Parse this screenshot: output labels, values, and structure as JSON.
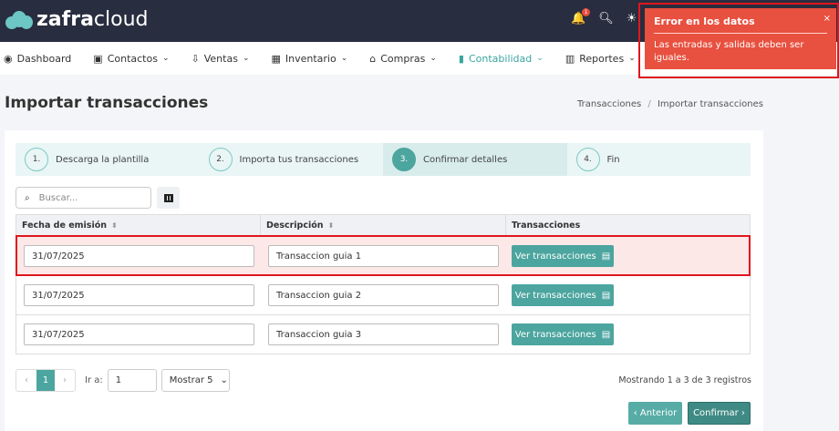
{
  "header": {
    "brand_bold": "zafra",
    "brand_light": "cloud",
    "notification_count": "1"
  },
  "nav": [
    {
      "label": "Dashboard",
      "icon": "dashboard-icon",
      "caret": false
    },
    {
      "label": "Contactos",
      "icon": "contacts-icon",
      "caret": true
    },
    {
      "label": "Ventas",
      "icon": "sales-icon",
      "caret": true
    },
    {
      "label": "Inventario",
      "icon": "inventory-icon",
      "caret": true
    },
    {
      "label": "Compras",
      "icon": "store-icon",
      "caret": true
    },
    {
      "label": "Contabilidad",
      "icon": "calculator-icon",
      "caret": true,
      "active": true
    },
    {
      "label": "Reportes",
      "icon": "chart-icon",
      "caret": true
    }
  ],
  "page": {
    "title": "Importar transacciones",
    "breadcrumb": [
      "Transacciones",
      "Importar transacciones"
    ],
    "breadcrumb_sep": "/"
  },
  "steps": [
    {
      "num": "1.",
      "label": "Descarga la plantilla"
    },
    {
      "num": "2.",
      "label": "Importa tus transacciones"
    },
    {
      "num": "3.",
      "label": "Confirmar detalles",
      "active": true
    },
    {
      "num": "4.",
      "label": "Fin"
    }
  ],
  "search": {
    "placeholder": "Buscar..."
  },
  "table": {
    "headers": [
      "Fecha de emisión",
      "Descripción",
      "Transacciones"
    ],
    "rows": [
      {
        "fecha": "31/07/2025",
        "descripcion": "Transaccion guia 1",
        "action": "Ver transacciones",
        "error": true
      },
      {
        "fecha": "31/07/2025",
        "descripcion": "Transaccion guia 2",
        "action": "Ver transacciones"
      },
      {
        "fecha": "31/07/2025",
        "descripcion": "Transaccion guia 3",
        "action": "Ver transacciones"
      }
    ]
  },
  "pagination": {
    "current": "1",
    "goto_label": "Ir a:",
    "goto_value": "1",
    "page_size": "Mostrar 5",
    "info": "Mostrando 1 a 3 de 3 registros"
  },
  "actions": {
    "prev": "‹ Anterior",
    "confirm": "Confirmar ›"
  },
  "toast": {
    "title": "Error en los datos",
    "message": "Las entradas y salidas deben ser iguales.",
    "close": "×"
  },
  "colors": {
    "header": "#282d3f",
    "accent": "#4ca59f",
    "toast": "#e8503f",
    "error_row": "#fde8e8"
  }
}
